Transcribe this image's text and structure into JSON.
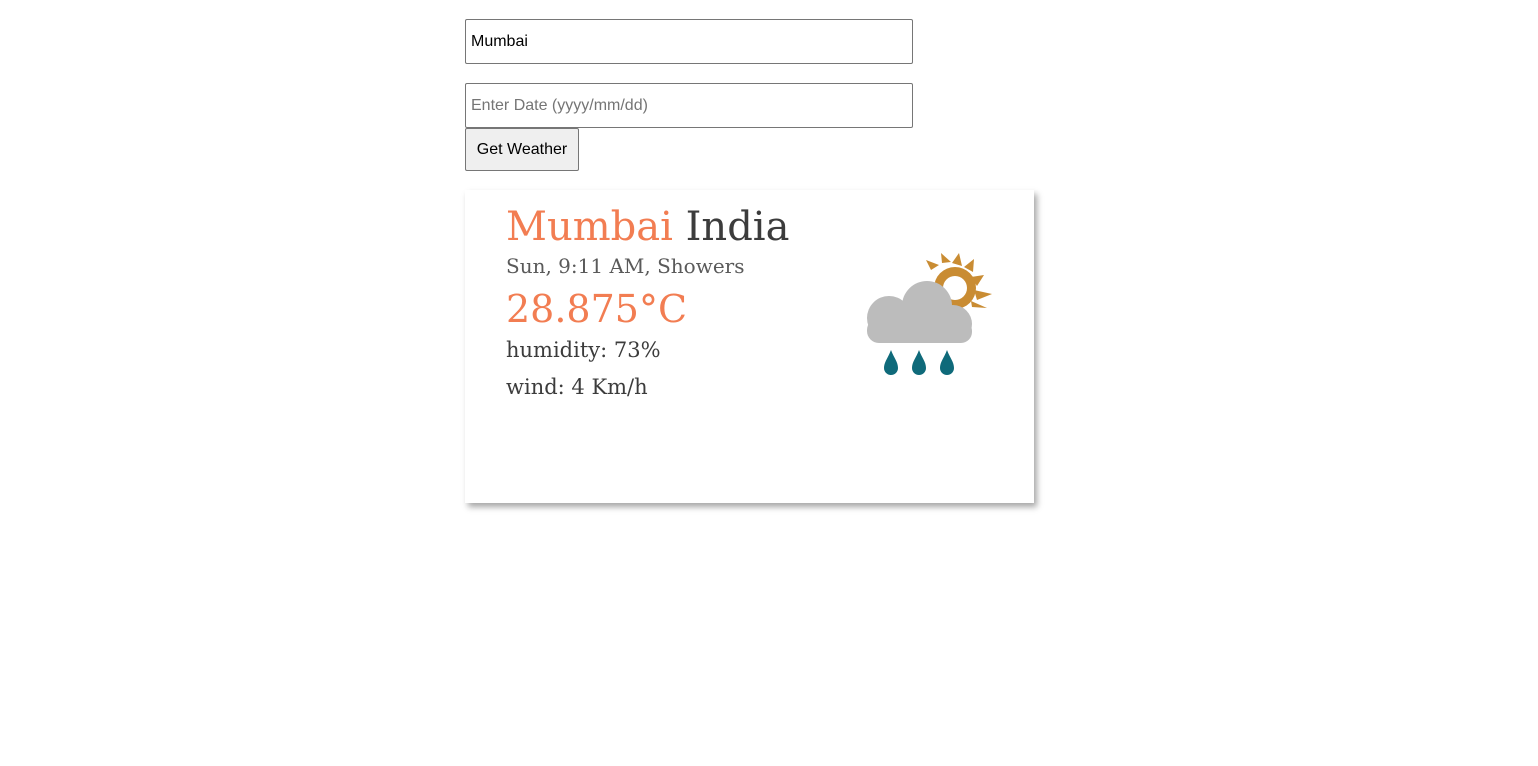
{
  "search": {
    "city_value": "Mumbai",
    "city_placeholder": "",
    "date_value": "",
    "date_placeholder": "Enter Date (yyyy/mm/dd)",
    "button_label": "Get Weather"
  },
  "weather": {
    "city": "Mumbai",
    "country": "India",
    "summary": "Sun, 9:11 AM, Showers",
    "temperature": "28.875°C",
    "humidity": "humidity: 73%",
    "wind": "wind: 4 Km/h",
    "icon": "showers-partly-cloudy-icon"
  },
  "colors": {
    "accent": "#f27d52",
    "text_dark": "#3c3c3c",
    "text_muted": "#5a5a5a",
    "sun": "#c98c33",
    "cloud": "#bcbcbc",
    "rain": "#0f6a7a"
  }
}
